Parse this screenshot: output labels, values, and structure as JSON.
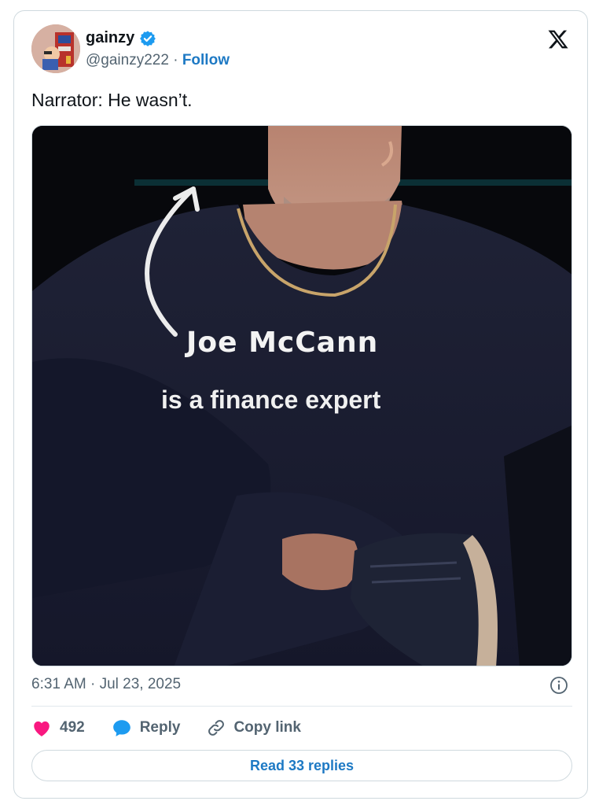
{
  "author": {
    "name": "gainzy",
    "handle": "@gainzy222",
    "separator": "·",
    "follow_label": "Follow",
    "verified": true
  },
  "tweet": {
    "text": "Narrator: He wasn’t.",
    "image_caption_line1": "Joe McCann",
    "image_caption_line2": "is a finance expert",
    "timestamp": "6:31 AM · Jul 23, 2025"
  },
  "actions": {
    "like_count": "492",
    "reply_label": "Reply",
    "copy_link_label": "Copy link"
  },
  "footer": {
    "read_replies_label": "Read 33 replies"
  },
  "colors": {
    "accent": "#1d79c4",
    "verified": "#1d9bf0",
    "like": "#f91880",
    "muted_text": "#536471",
    "border": "#cfd9de"
  },
  "icons": {
    "verified": "verified-badge-icon",
    "x_logo": "x-logo-icon",
    "info": "info-icon",
    "like": "heart-icon",
    "reply": "speech-bubble-icon",
    "copy_link": "link-icon"
  }
}
